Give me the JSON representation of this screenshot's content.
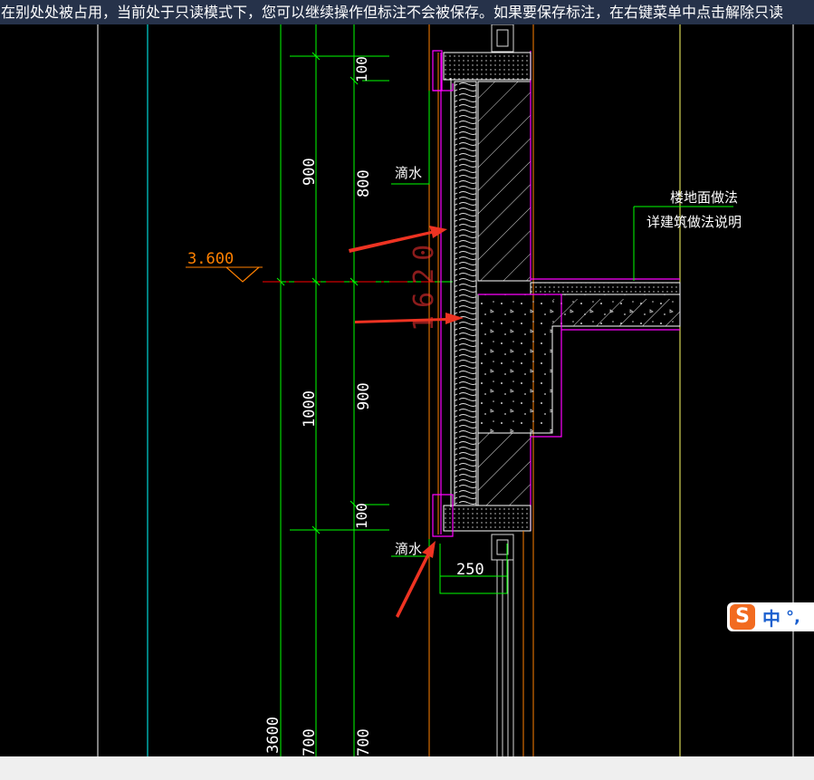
{
  "notice_bar": {
    "text": "在别处处被占用，当前处于只读模式下，您可以继续操作但标注不会被保存。如果要保存标注，在右键菜单中点击解除只读"
  },
  "drawing": {
    "dimensions": {
      "d_100_top": "100",
      "d_900_left": "900",
      "d_800": "800",
      "d_1000": "1000",
      "d_900_right": "900",
      "d_100_bottom": "100",
      "d_1620": "1620",
      "d_250": "250",
      "d_3600": "3600",
      "d_700_a": "700",
      "d_700_b": "700"
    },
    "elevation": "3.600",
    "labels": {
      "drip_top": "滴水",
      "drip_bottom": "滴水",
      "floor_method": "楼地面做法",
      "see_arch_notes": "详建筑做法说明"
    },
    "colors": {
      "dim_green": "#00ff00",
      "axis_red": "#ff0000",
      "wall_magenta": "#ff00ff",
      "cyan_line": "#00ffff",
      "annotation_arrow": "#ee3322",
      "orange_line": "#ff8000"
    }
  },
  "ime": {
    "mode": "中",
    "punct": "°,"
  }
}
